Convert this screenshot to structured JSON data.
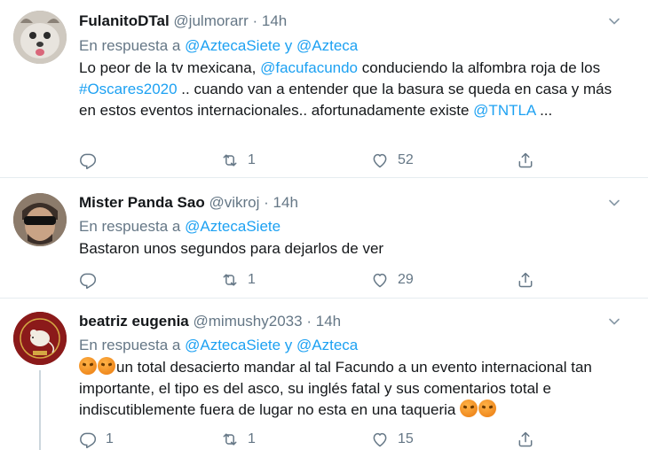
{
  "tweets": [
    {
      "name": "FulanitoDTal",
      "handle": "@julmorarr",
      "time": "14h",
      "reply_prefix": "En respuesta a",
      "reply_to": "@AztecaSiete y @Azteca",
      "body": {
        "t1": "Lo peor de la tv mexicana, ",
        "m1": "@facufacundo",
        "t2": " conduciendo la alfombra roja de los ",
        "m2": "#Oscares2020",
        "t3": "  .. cuando van a entender que la basura se queda en casa y más en estos eventos internacionales.. afortunadamente existe ",
        "m3": "@TNTLA",
        "t4": " ..."
      },
      "replies": "",
      "retweets": "1",
      "likes": "52"
    },
    {
      "name": "Mister Panda Sao",
      "handle": "@vikroj",
      "time": "14h",
      "reply_prefix": "En respuesta a",
      "reply_to": "@AztecaSiete",
      "body": {
        "t1": "Bastaron unos segundos para dejarlos de ver"
      },
      "replies": "",
      "retweets": "1",
      "likes": "29"
    },
    {
      "name": "beatriz eugenia",
      "handle": "@mimushy2033",
      "time": "14h",
      "reply_prefix": "En respuesta a",
      "reply_to": "@AztecaSiete y @Azteca",
      "body": {
        "t1": "un total desacierto mandar al tal Facundo a un evento internacional tan importante, el tipo es del asco, su inglés fatal y sus comentarios total e indiscutiblemente fuera de lugar no esta en una taqueria "
      },
      "replies": "1",
      "retweets": "1",
      "likes": "15"
    }
  ],
  "separator": "·",
  "icons": [
    "chevron-down-icon",
    "reply-icon",
    "retweet-icon",
    "like-icon",
    "share-icon",
    "angry-face-emoji"
  ],
  "colors": {
    "link": "#1da1f2",
    "muted": "#657786",
    "text": "#14171a",
    "border": "#e6ecf0"
  }
}
